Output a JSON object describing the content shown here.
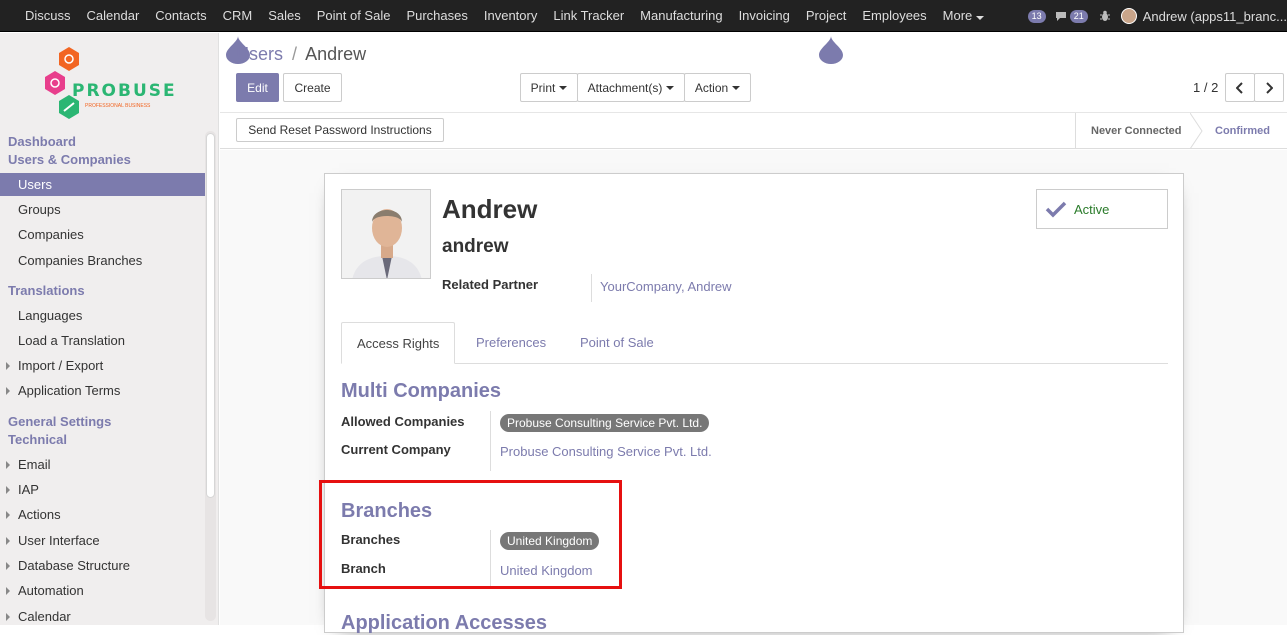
{
  "topnav": {
    "items": [
      "Discuss",
      "Calendar",
      "Contacts",
      "CRM",
      "Sales",
      "Point of Sale",
      "Purchases",
      "Inventory",
      "Link Tracker",
      "Manufacturing",
      "Invoicing",
      "Project",
      "Employees",
      "More"
    ],
    "badge_activity": "13",
    "badge_messages": "21",
    "user_label": "Andrew (apps11_branc..."
  },
  "sidebar": {
    "dashboard": "Dashboard",
    "users_companies": "Users & Companies",
    "items_uc": [
      "Users",
      "Groups",
      "Companies",
      "Companies Branches"
    ],
    "translations": "Translations",
    "items_tr": [
      "Languages",
      "Load a Translation",
      "Import / Export",
      "Application Terms"
    ],
    "general_settings": "General Settings",
    "technical": "Technical",
    "items_tech": [
      "Email",
      "IAP",
      "Actions",
      "User Interface",
      "Database Structure",
      "Automation",
      "Calendar"
    ]
  },
  "logo": {
    "brand": "PROBUSE",
    "tagline": "PROFESSIONAL BUSINESS"
  },
  "control": {
    "breadcrumb_parent": "Users",
    "breadcrumb_sep": "/",
    "breadcrumb_current": "Andrew",
    "edit": "Edit",
    "create": "Create",
    "print": "Print",
    "attachments": "Attachment(s)",
    "action": "Action",
    "pager": "1 / 2"
  },
  "statusbar": {
    "reset_btn": "Send Reset Password Instructions",
    "stage_never": "Never Connected",
    "stage_confirmed": "Confirmed"
  },
  "form": {
    "name": "Andrew",
    "login": "andrew",
    "related_partner_label": "Related Partner",
    "related_partner_value": "YourCompany, Andrew",
    "active_label": "Active",
    "tabs": [
      "Access Rights",
      "Preferences",
      "Point of Sale"
    ],
    "multi_companies_title": "Multi Companies",
    "allowed_companies_label": "Allowed Companies",
    "allowed_companies_tag": "Probuse Consulting Service Pvt. Ltd.",
    "current_company_label": "Current Company",
    "current_company_value": "Probuse Consulting Service Pvt. Ltd.",
    "branches_title": "Branches",
    "branches_label": "Branches",
    "branches_tag": "United Kingdom",
    "branch_label": "Branch",
    "branch_value": "United Kingdom",
    "app_accesses_title": "Application Accesses"
  },
  "colors": {
    "accent": "#7c7bad",
    "highlight": "#e61010",
    "topbar": "#222222"
  }
}
